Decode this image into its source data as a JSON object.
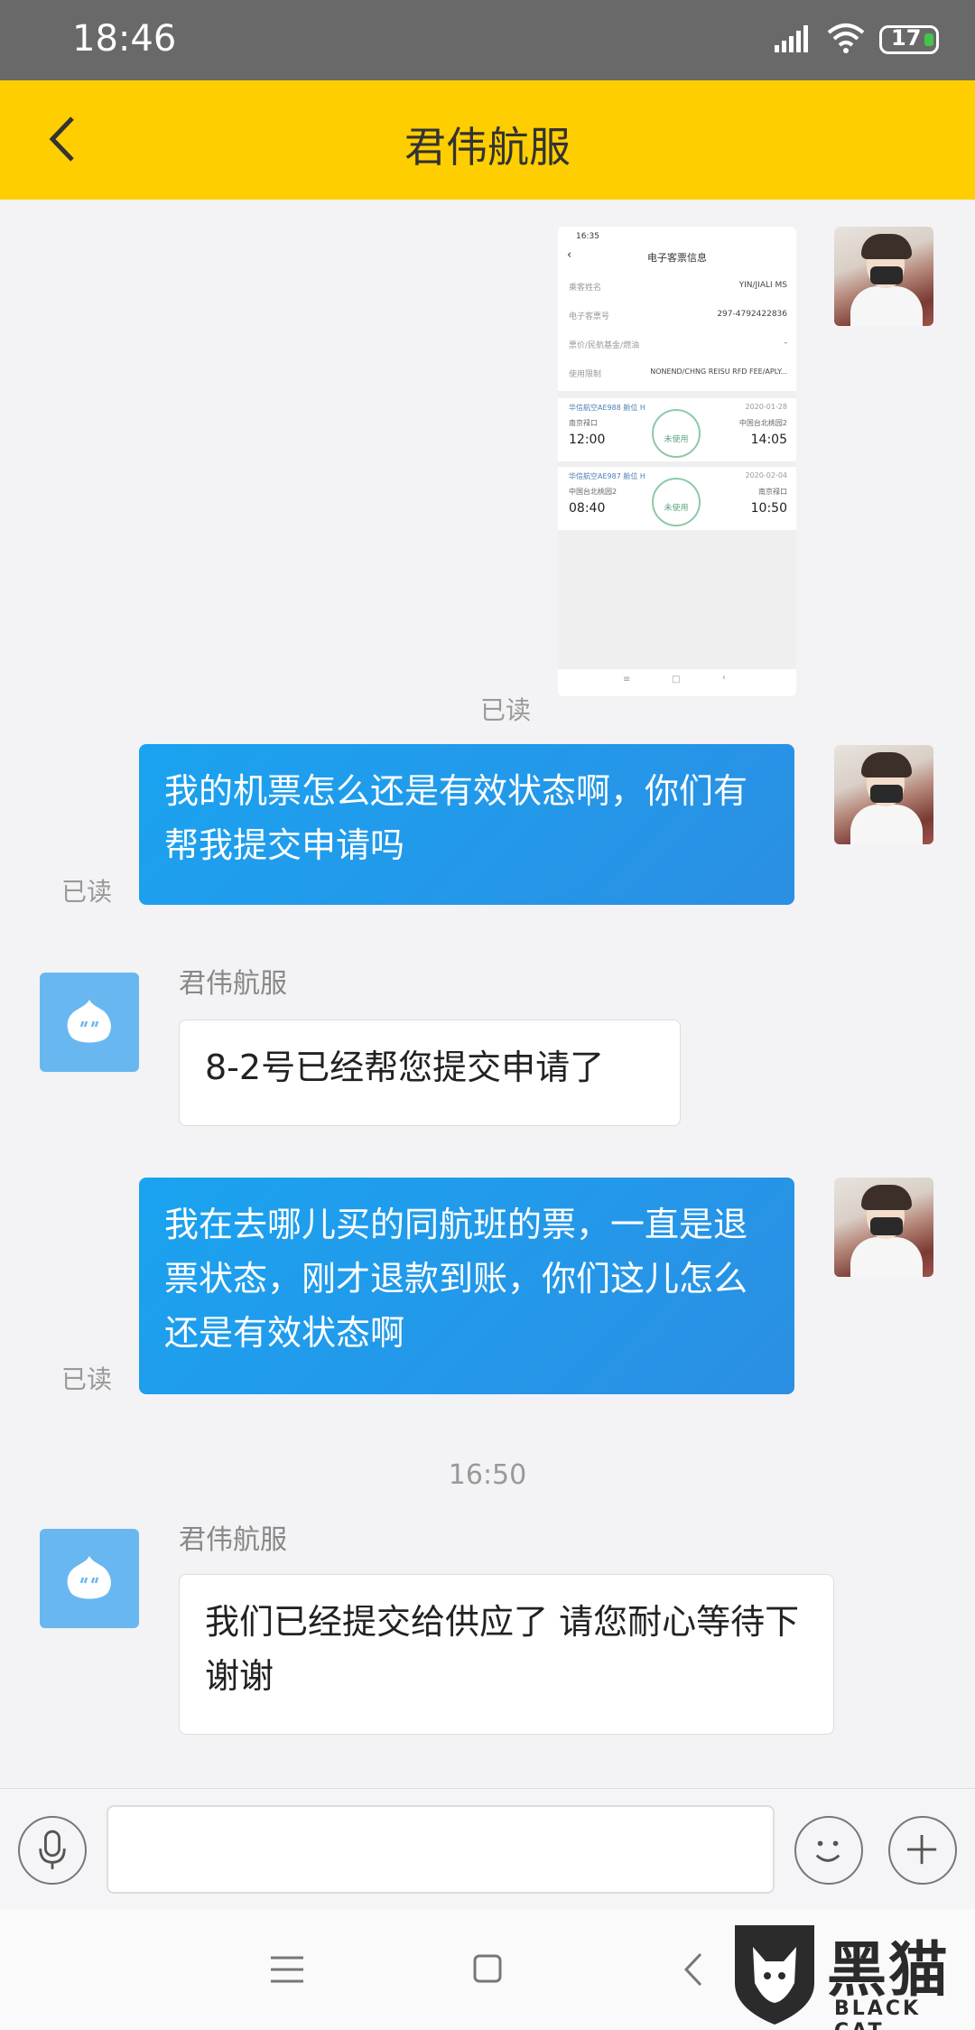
{
  "status_bar": {
    "time": "18:46",
    "battery": "17"
  },
  "header": {
    "title": "君伟航服"
  },
  "image_message": {
    "read_label": "已读",
    "screenshot": {
      "time": "16:35",
      "title": "电子客票信息",
      "rows": [
        {
          "key": "乘客姓名",
          "value": "YIN/JIALI MS"
        },
        {
          "key": "电子客票号",
          "value": "297-4792422836"
        },
        {
          "key": "票价/民航基金/燃油",
          "value": "-"
        },
        {
          "key": "使用限制",
          "value": "NONEND/CHNG REISU RFD FEE/APLY..."
        }
      ],
      "segments": [
        {
          "flight": "华信航空AE988 舱位 H",
          "date": "2020-01-28",
          "from": "南京禄口",
          "to": "中国台北桃园2",
          "dep": "12:00",
          "arr": "14:05",
          "status": "未使用"
        },
        {
          "flight": "华信航空AE987 舱位 H",
          "date": "2020-02-04",
          "from": "中国台北桃园2",
          "to": "南京禄口",
          "dep": "08:40",
          "arr": "10:50",
          "status": "未使用"
        }
      ],
      "nav_back": "‹",
      "nav_home": "□",
      "nav_menu": "≡"
    }
  },
  "messages": [
    {
      "text": "我的机票怎么还是有效状态啊，你们有帮我提交申请吗",
      "read_label": "已读"
    },
    {
      "sender": "君伟航服",
      "text": "8-2号已经帮您提交申请了"
    },
    {
      "text": "我在去哪儿买的同航班的票，一直是退票状态，刚才退款到账，你们这儿怎么还是有效状态啊",
      "read_label": "已读"
    },
    {
      "timestamp": "16:50"
    },
    {
      "sender": "君伟航服",
      "text": "我们已经提交给供应了 请您耐心等待下 谢谢"
    }
  ],
  "input": {
    "value": ""
  },
  "watermark": {
    "cn": "黑猫",
    "en": "BLACK CAT"
  },
  "colors": {
    "header": "#ffce00",
    "outgoing_bubble": "#1aa3f0",
    "bot_avatar": "#69b7f1",
    "status_bar": "#696969"
  }
}
